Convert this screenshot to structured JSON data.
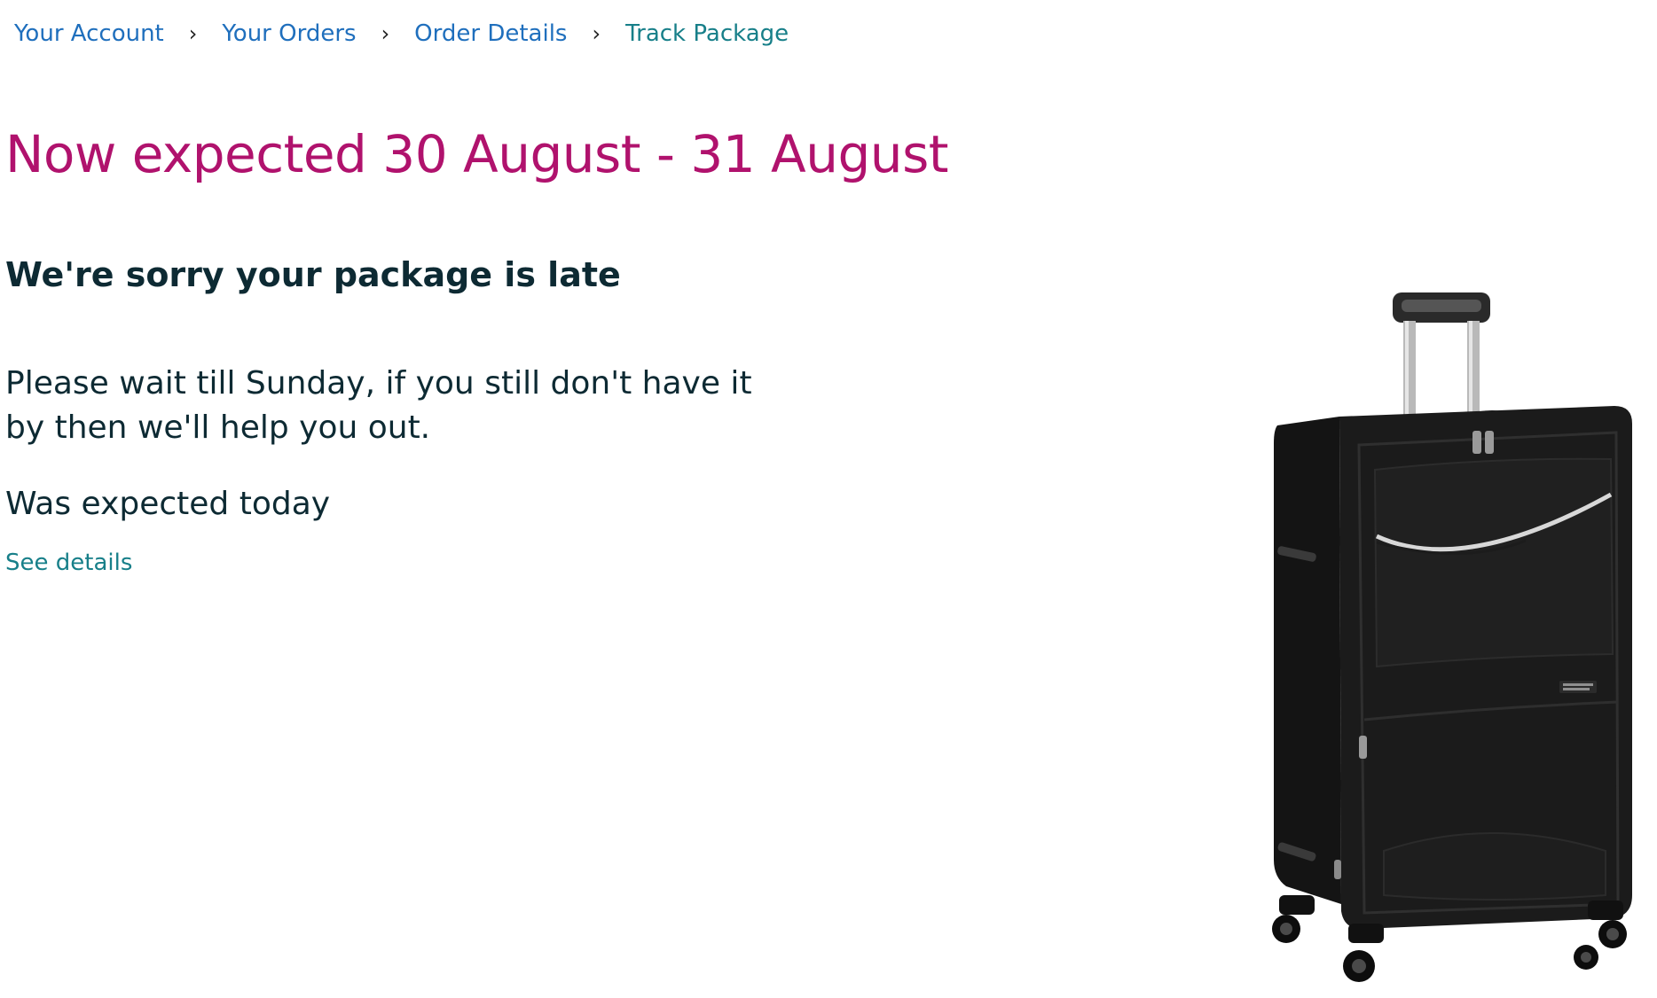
{
  "breadcrumb": {
    "items": [
      {
        "label": "Your Account"
      },
      {
        "label": "Your Orders"
      },
      {
        "label": "Order Details"
      },
      {
        "label": "Track Package"
      }
    ],
    "separator": "›"
  },
  "status": {
    "headline": "Now expected 30 August - 31 August",
    "apology": "We're sorry your package is late",
    "message": "Please wait till Sunday, if you still don't have it by then we'll help you out.",
    "was_expected": "Was expected today",
    "see_details": "See details"
  },
  "product": {
    "image_icon": "suitcase-image"
  },
  "colors": {
    "link": "#1f6fbd",
    "link_current": "#177f89",
    "headline": "#b0126d",
    "text": "#0d2a33"
  }
}
